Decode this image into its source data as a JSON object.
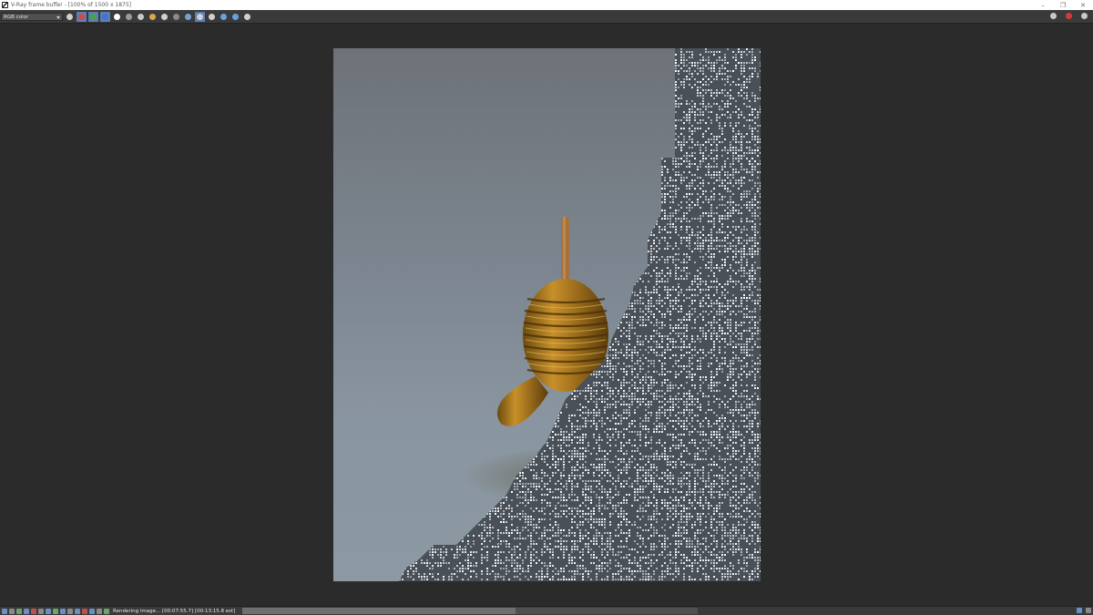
{
  "window": {
    "title": "V-Ray frame buffer - [100% of 1500 x 1875]",
    "controls": {
      "minimize": "–",
      "maximize": "❐",
      "close": "✕"
    }
  },
  "toolbar": {
    "channel": "RGB color",
    "buttons": [
      {
        "name": "show-correction-icon",
        "color": "#d0d0d0"
      },
      {
        "name": "red-channel-icon",
        "color": "#d24a4a",
        "active": true
      },
      {
        "name": "green-channel-icon",
        "color": "#4aa34a",
        "active": true
      },
      {
        "name": "blue-channel-icon",
        "color": "#4a6fd2",
        "active": true
      },
      {
        "name": "view-alpha-icon",
        "color": "#ffffff"
      },
      {
        "name": "monochrome-icon",
        "color": "#9a9a9a"
      },
      {
        "name": "save-image-icon",
        "color": "#c8c8c8"
      },
      {
        "name": "load-image-icon",
        "color": "#d8a64a"
      },
      {
        "name": "clear-image-icon",
        "color": "#d0d0d0"
      },
      {
        "name": "duplicate-to-vfb-icon",
        "color": "#8a8a8a"
      },
      {
        "name": "region-render-icon",
        "color": "#7aa0d0"
      },
      {
        "name": "track-mouse-icon",
        "color": "#d0d0d0",
        "active": true
      },
      {
        "name": "link-to-3dsmax-icon",
        "color": "#d0d0d0"
      },
      {
        "name": "show-lens-effects-icon",
        "color": "#6aa0e0"
      },
      {
        "name": "render-history-icon",
        "color": "#6aa0e0"
      },
      {
        "name": "pixel-info-icon",
        "color": "#d0d0d0"
      }
    ],
    "right_buttons": [
      {
        "name": "render-settings-icon",
        "color": "#c8c8c8"
      },
      {
        "name": "stop-render-icon",
        "color": "#d43a3a"
      },
      {
        "name": "render-region-icon",
        "color": "#c8c8c8"
      }
    ]
  },
  "status": {
    "text": "Rendering image... [00:07:55.7] [00:13:15.8 est]",
    "progress": 0.6
  },
  "statusbar_icons": [
    "frame-icon",
    "frame-icon",
    "lock-icon",
    "histogram-icon",
    "lut-icon",
    "curves-icon",
    "color-icon",
    "stats-icon",
    "exposure-icon",
    "white-balance-icon",
    "levels-icon",
    "bloom-icon",
    "glare-icon",
    "settings-icon",
    "hue-icon"
  ]
}
